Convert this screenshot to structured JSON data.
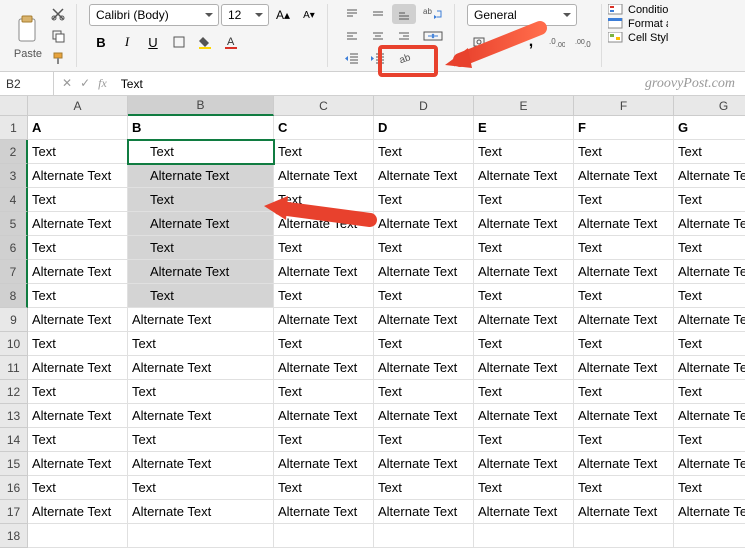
{
  "ribbon": {
    "paste_label": "Paste",
    "font_name": "Calibri (Body)",
    "font_size": "12",
    "number_format": "General",
    "bold": "B",
    "italic": "I",
    "underline": "U",
    "cond_format": "Conditional Formatting",
    "format_table": "Format as Table",
    "cell_styles": "Cell Styles"
  },
  "formula": {
    "name_box": "B2",
    "value": "Text"
  },
  "watermark": "groovyPost.com",
  "cols": [
    "A",
    "B",
    "C",
    "D",
    "E",
    "F",
    "G"
  ],
  "rows": [
    {
      "n": "1",
      "bold": true,
      "c": [
        "A",
        "B",
        "C",
        "D",
        "E",
        "F",
        "G"
      ]
    },
    {
      "n": "2",
      "c": [
        "Text",
        "Text",
        "Text",
        "Text",
        "Text",
        "Text",
        "Text"
      ]
    },
    {
      "n": "3",
      "c": [
        "Alternate Text",
        "Alternate Text",
        "Alternate Text",
        "Alternate Text",
        "Alternate Text",
        "Alternate Text",
        "Alternate Text"
      ]
    },
    {
      "n": "4",
      "c": [
        "Text",
        "Text",
        "Text",
        "Text",
        "Text",
        "Text",
        "Text"
      ]
    },
    {
      "n": "5",
      "c": [
        "Alternate Text",
        "Alternate Text",
        "Alternate Text",
        "Alternate Text",
        "Alternate Text",
        "Alternate Text",
        "Alternate Text"
      ]
    },
    {
      "n": "6",
      "c": [
        "Text",
        "Text",
        "Text",
        "Text",
        "Text",
        "Text",
        "Text"
      ]
    },
    {
      "n": "7",
      "c": [
        "Alternate Text",
        "Alternate Text",
        "Alternate Text",
        "Alternate Text",
        "Alternate Text",
        "Alternate Text",
        "Alternate Text"
      ]
    },
    {
      "n": "8",
      "c": [
        "Text",
        "Text",
        "Text",
        "Text",
        "Text",
        "Text",
        "Text"
      ]
    },
    {
      "n": "9",
      "c": [
        "Alternate Text",
        "Alternate Text",
        "Alternate Text",
        "Alternate Text",
        "Alternate Text",
        "Alternate Text",
        "Alternate Text"
      ]
    },
    {
      "n": "10",
      "c": [
        "Text",
        "Text",
        "Text",
        "Text",
        "Text",
        "Text",
        "Text"
      ]
    },
    {
      "n": "11",
      "c": [
        "Alternate Text",
        "Alternate Text",
        "Alternate Text",
        "Alternate Text",
        "Alternate Text",
        "Alternate Text",
        "Alternate Text"
      ]
    },
    {
      "n": "12",
      "c": [
        "Text",
        "Text",
        "Text",
        "Text",
        "Text",
        "Text",
        "Text"
      ]
    },
    {
      "n": "13",
      "c": [
        "Alternate Text",
        "Alternate Text",
        "Alternate Text",
        "Alternate Text",
        "Alternate Text",
        "Alternate Text",
        "Alternate Text"
      ]
    },
    {
      "n": "14",
      "c": [
        "Text",
        "Text",
        "Text",
        "Text",
        "Text",
        "Text",
        "Text"
      ]
    },
    {
      "n": "15",
      "c": [
        "Alternate Text",
        "Alternate Text",
        "Alternate Text",
        "Alternate Text",
        "Alternate Text",
        "Alternate Text",
        "Alternate Text"
      ]
    },
    {
      "n": "16",
      "c": [
        "Text",
        "Text",
        "Text",
        "Text",
        "Text",
        "Text",
        "Text"
      ]
    },
    {
      "n": "17",
      "c": [
        "Alternate Text",
        "Alternate Text",
        "Alternate Text",
        "Alternate Text",
        "Alternate Text",
        "Alternate Text",
        "Alternate Text"
      ]
    },
    {
      "n": "18",
      "c": [
        "",
        "",
        "",
        "",
        "",
        "",
        ""
      ]
    }
  ],
  "selection": {
    "active": "B2",
    "range_start_row": 2,
    "range_end_row": 8,
    "col": "B",
    "indented": true
  }
}
